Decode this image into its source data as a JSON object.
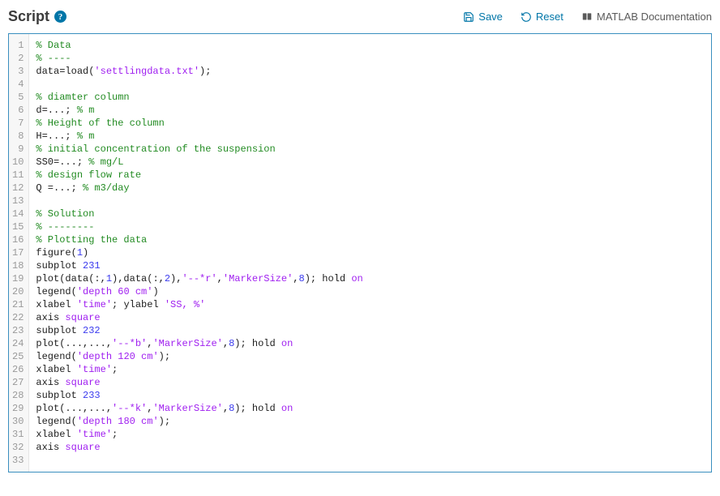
{
  "header": {
    "title": "Script",
    "help_glyph": "?"
  },
  "toolbar": {
    "save_label": "Save",
    "reset_label": "Reset",
    "docs_label": "MATLAB Documentation"
  },
  "editor": {
    "lines": [
      [
        {
          "t": "comment",
          "v": "% Data"
        }
      ],
      [
        {
          "t": "comment",
          "v": "% ----"
        }
      ],
      [
        {
          "t": "default",
          "v": "data=load("
        },
        {
          "t": "string",
          "v": "'settlingdata.txt'"
        },
        {
          "t": "default",
          "v": ");"
        }
      ],
      [],
      [
        {
          "t": "comment",
          "v": "% diamter column"
        }
      ],
      [
        {
          "t": "default",
          "v": "d=...; "
        },
        {
          "t": "comment",
          "v": "% m"
        }
      ],
      [
        {
          "t": "comment",
          "v": "% Height of the column"
        }
      ],
      [
        {
          "t": "default",
          "v": "H=...; "
        },
        {
          "t": "comment",
          "v": "% m"
        }
      ],
      [
        {
          "t": "comment",
          "v": "% initial concentration of the suspension"
        }
      ],
      [
        {
          "t": "default",
          "v": "SS0=...; "
        },
        {
          "t": "comment",
          "v": "% mg/L"
        }
      ],
      [
        {
          "t": "comment",
          "v": "% design flow rate"
        }
      ],
      [
        {
          "t": "default",
          "v": "Q =...; "
        },
        {
          "t": "comment",
          "v": "% m3/day"
        }
      ],
      [],
      [
        {
          "t": "comment",
          "v": "% Solution"
        }
      ],
      [
        {
          "t": "comment",
          "v": "% --------"
        }
      ],
      [
        {
          "t": "comment",
          "v": "% Plotting the data"
        }
      ],
      [
        {
          "t": "default",
          "v": "figure("
        },
        {
          "t": "number",
          "v": "1"
        },
        {
          "t": "default",
          "v": ")"
        }
      ],
      [
        {
          "t": "default",
          "v": "subplot "
        },
        {
          "t": "number",
          "v": "231"
        }
      ],
      [
        {
          "t": "default",
          "v": "plot(data(:,"
        },
        {
          "t": "number",
          "v": "1"
        },
        {
          "t": "default",
          "v": "),data(:,"
        },
        {
          "t": "number",
          "v": "2"
        },
        {
          "t": "default",
          "v": "),"
        },
        {
          "t": "string",
          "v": "'--*r'"
        },
        {
          "t": "default",
          "v": ","
        },
        {
          "t": "string",
          "v": "'MarkerSize'"
        },
        {
          "t": "default",
          "v": ","
        },
        {
          "t": "number",
          "v": "8"
        },
        {
          "t": "default",
          "v": "); hold "
        },
        {
          "t": "string",
          "v": "on"
        }
      ],
      [
        {
          "t": "default",
          "v": "legend("
        },
        {
          "t": "string",
          "v": "'depth 60 cm'"
        },
        {
          "t": "default",
          "v": ")"
        }
      ],
      [
        {
          "t": "default",
          "v": "xlabel "
        },
        {
          "t": "string",
          "v": "'time'"
        },
        {
          "t": "default",
          "v": "; ylabel "
        },
        {
          "t": "string",
          "v": "'SS, %'"
        }
      ],
      [
        {
          "t": "default",
          "v": "axis "
        },
        {
          "t": "string",
          "v": "square"
        }
      ],
      [
        {
          "t": "default",
          "v": "subplot "
        },
        {
          "t": "number",
          "v": "232"
        }
      ],
      [
        {
          "t": "default",
          "v": "plot(...,...,"
        },
        {
          "t": "string",
          "v": "'--*b'"
        },
        {
          "t": "default",
          "v": ","
        },
        {
          "t": "string",
          "v": "'MarkerSize'"
        },
        {
          "t": "default",
          "v": ","
        },
        {
          "t": "number",
          "v": "8"
        },
        {
          "t": "default",
          "v": "); hold "
        },
        {
          "t": "string",
          "v": "on"
        }
      ],
      [
        {
          "t": "default",
          "v": "legend("
        },
        {
          "t": "string",
          "v": "'depth 120 cm'"
        },
        {
          "t": "default",
          "v": ");"
        }
      ],
      [
        {
          "t": "default",
          "v": "xlabel "
        },
        {
          "t": "string",
          "v": "'time'"
        },
        {
          "t": "default",
          "v": ";"
        }
      ],
      [
        {
          "t": "default",
          "v": "axis "
        },
        {
          "t": "string",
          "v": "square"
        }
      ],
      [
        {
          "t": "default",
          "v": "subplot "
        },
        {
          "t": "number",
          "v": "233"
        }
      ],
      [
        {
          "t": "default",
          "v": "plot(...,...,"
        },
        {
          "t": "string",
          "v": "'--*k'"
        },
        {
          "t": "default",
          "v": ","
        },
        {
          "t": "string",
          "v": "'MarkerSize'"
        },
        {
          "t": "default",
          "v": ","
        },
        {
          "t": "number",
          "v": "8"
        },
        {
          "t": "default",
          "v": "); hold "
        },
        {
          "t": "string",
          "v": "on"
        }
      ],
      [
        {
          "t": "default",
          "v": "legend("
        },
        {
          "t": "string",
          "v": "'depth 180 cm'"
        },
        {
          "t": "default",
          "v": ");"
        }
      ],
      [
        {
          "t": "default",
          "v": "xlabel "
        },
        {
          "t": "string",
          "v": "'time'"
        },
        {
          "t": "default",
          "v": ";"
        }
      ],
      [
        {
          "t": "default",
          "v": "axis "
        },
        {
          "t": "string",
          "v": "square"
        }
      ],
      []
    ]
  }
}
